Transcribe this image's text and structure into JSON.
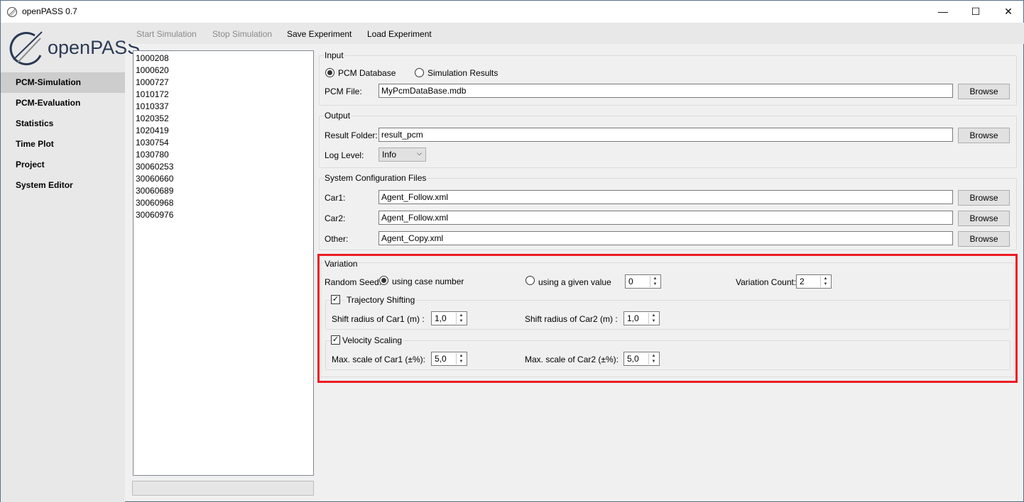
{
  "window": {
    "title": "openPASS 0.7",
    "minimize": "—",
    "maximize": "☐",
    "close": "✕"
  },
  "logo": {
    "text": "openPASS"
  },
  "sidebar": {
    "items": [
      {
        "label": "PCM-Simulation",
        "selected": true
      },
      {
        "label": "PCM-Evaluation"
      },
      {
        "label": "Statistics"
      },
      {
        "label": "Time Plot"
      },
      {
        "label": "Project"
      },
      {
        "label": "System Editor"
      }
    ]
  },
  "toolbar": {
    "start": "Start Simulation",
    "stop": "Stop Simulation",
    "save": "Save Experiment",
    "load": "Load Experiment"
  },
  "cases": [
    "1000208",
    "1000620",
    "1000727",
    "1010172",
    "1010337",
    "1020352",
    "1020419",
    "1030754",
    "1030780",
    "30060253",
    "30060660",
    "30060689",
    "30060968",
    "30060976"
  ],
  "input": {
    "title": "Input",
    "radio_pcm": "PCM Database",
    "radio_sim": "Simulation Results",
    "pcm_file_label": "PCM File:",
    "pcm_file": "MyPcmDataBase.mdb",
    "browse": "Browse"
  },
  "output": {
    "title": "Output",
    "result_label": "Result Folder:",
    "result_folder": "result_pcm",
    "log_label": "Log Level:",
    "log_level": "Info",
    "browse": "Browse"
  },
  "sysconfig": {
    "title": "System Configuration Files",
    "car1_label": "Car1:",
    "car1": "Agent_Follow.xml",
    "car2_label": "Car2:",
    "car2": "Agent_Follow.xml",
    "other_label": "Other:",
    "other": "Agent_Copy.xml",
    "browse": "Browse"
  },
  "variation": {
    "title": "Variation",
    "seed_label": "Random Seed:",
    "seed_case": "using case number",
    "seed_given": "using a given value",
    "seed_value": "0",
    "count_label": "Variation Count:",
    "count": "2",
    "traj_label": "Trajectory Shifting",
    "shift1_label": "Shift radius of Car1 (m) :",
    "shift1": "1,0",
    "shift2_label": "Shift radius of Car2 (m) :",
    "shift2": "1,0",
    "vel_label": "Velocity Scaling",
    "scale1_label": "Max. scale of Car1 (±%):",
    "scale1": "5,0",
    "scale2_label": "Max. scale of Car2 (±%):",
    "scale2": "5,0"
  },
  "highlight_color": "#ed1c24"
}
